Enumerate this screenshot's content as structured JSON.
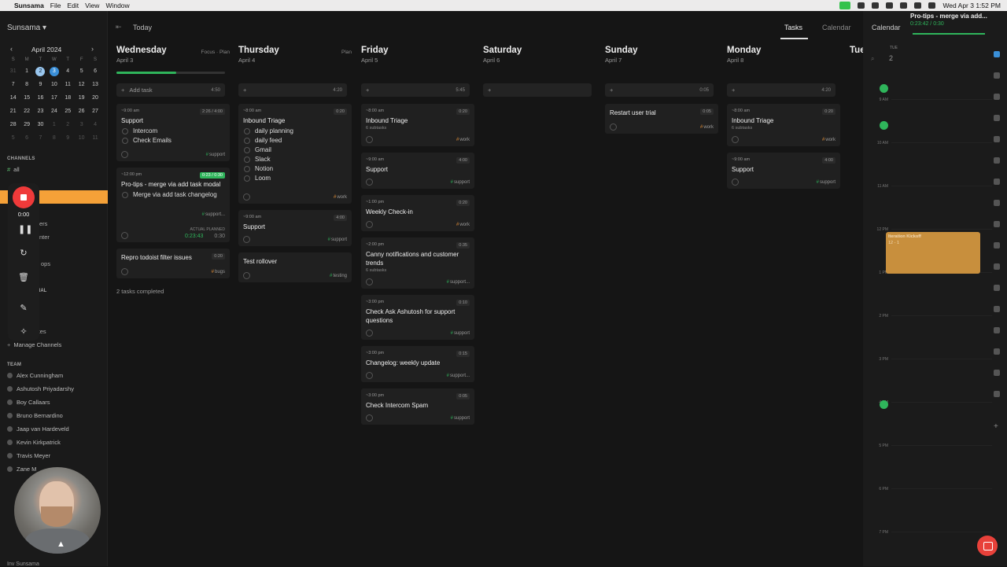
{
  "menubar": {
    "app": "Sunsama",
    "menus": [
      "File",
      "Edit",
      "View",
      "Window"
    ],
    "clock": "Wed Apr 3  1:52 PM"
  },
  "sidebar": {
    "brand": "Sunsama ▾",
    "calendar": {
      "month": "April 2024",
      "dow": [
        "S",
        "M",
        "T",
        "W",
        "T",
        "F",
        "S"
      ],
      "weeks": [
        [
          "31",
          "1",
          "2",
          "3",
          "4",
          "5",
          "6"
        ],
        [
          "7",
          "8",
          "9",
          "10",
          "11",
          "12",
          "13"
        ],
        [
          "14",
          "15",
          "16",
          "17",
          "18",
          "19",
          "20"
        ],
        [
          "21",
          "22",
          "23",
          "24",
          "25",
          "26",
          "27"
        ],
        [
          "28",
          "29",
          "30",
          "1",
          "2",
          "3",
          "4"
        ],
        [
          "5",
          "6",
          "7",
          "8",
          "9",
          "10",
          "11"
        ]
      ]
    },
    "channels_label": "CHANNELS",
    "channel_all": "all",
    "manage_channels": "Manage Channels",
    "team_label": "TEAM",
    "team": [
      "Alex Cunningham",
      "Ashutosh Priyadarshy",
      "Boy Callaars",
      "Bruno Bernardino",
      "Jaap van Hardeveld",
      "Kevin Kirkpatrick",
      "Travis Meyer",
      "Zane M"
    ],
    "fragments": {
      "ers": "ers",
      "nter": "nter",
      "ops": "ops",
      "nal": "NAL",
      "kes": "kes"
    },
    "bottom": "Inv      Sunsama"
  },
  "recorder": {
    "time": "0:00"
  },
  "topbar": {
    "today": "Today",
    "tab_tasks": "Tasks",
    "tab_calendar": "Calendar"
  },
  "days": [
    {
      "name": "Wednesday",
      "date": "April 3",
      "links": "Focus · Plan",
      "add": "Add task",
      "add_dur": "4:50",
      "cards": [
        {
          "time": "~9:00 am",
          "title": "Support",
          "dur": "2:26 / 4:00",
          "subtasks": [
            "Intercom",
            "Check Emails"
          ],
          "tag": "support"
        },
        {
          "time": "~12:00 pm",
          "title": "Pro-tips - merge via add task modal",
          "dur": "0:23 / 0:30",
          "subtasks": [
            "Merge via add task changelog"
          ],
          "tag": "support...",
          "actual_label": "ACTUAL",
          "planned_label": "PLANNED",
          "actual": "0:23:43",
          "planned": "0:30"
        },
        {
          "time": "",
          "title": "Repro todoist filter issues",
          "dur": "0:20",
          "subtasks": [],
          "tag": "bugs"
        }
      ],
      "completed": "2 tasks completed"
    },
    {
      "name": "Thursday",
      "date": "April 4",
      "links": "Plan",
      "add": "",
      "add_dur": "4:20",
      "cards": [
        {
          "time": "~8:00 am",
          "title": "Inbound Triage",
          "dur": "0:20",
          "subtasks": [
            "daily planning",
            "daily feed",
            "Gmail",
            "Slack",
            "Notion",
            "Loom"
          ],
          "tag": "work"
        },
        {
          "time": "~9:00 am",
          "title": "Support",
          "dur": "4:00",
          "subtasks": [],
          "tag": "support"
        },
        {
          "time": "",
          "title": "Test rollover",
          "dur": "",
          "subtasks": [],
          "tag": "testing"
        }
      ]
    },
    {
      "name": "Friday",
      "date": "April 5",
      "links": "",
      "add": "",
      "add_dur": "5:45",
      "cards": [
        {
          "time": "~8:00 am",
          "title": "Inbound Triage",
          "sub": "6 subtasks",
          "dur": "0:20",
          "tag": "work"
        },
        {
          "time": "~9:00 am",
          "title": "Support",
          "dur": "4:00",
          "tag": "support"
        },
        {
          "time": "~1:00 pm",
          "title": "Weekly Check-in",
          "dur": "0:20",
          "tag": "work"
        },
        {
          "time": "~2:00 pm",
          "title": "Canny notifications and customer trends",
          "sub": "6 subtasks",
          "dur": "0:35",
          "tag": "support..."
        },
        {
          "time": "~3:00 pm",
          "title": "Check Ask Ashutosh for support questions",
          "dur": "0:10",
          "tag": "support"
        },
        {
          "time": "~3:00 pm",
          "title": "Changelog: weekly update",
          "dur": "0:15",
          "tag": "support..."
        },
        {
          "time": "~3:00 pm",
          "title": "Check Intercom Spam",
          "dur": "0:05",
          "tag": "support"
        }
      ]
    },
    {
      "name": "Saturday",
      "date": "April 6",
      "links": "",
      "add": "",
      "add_dur": "",
      "cards": []
    },
    {
      "name": "Sunday",
      "date": "April 7",
      "links": "",
      "add": "",
      "add_dur": "0:05",
      "cards": [
        {
          "time": "",
          "title": "Restart user trial",
          "dur": "0:05",
          "tag": "work"
        }
      ]
    },
    {
      "name": "Monday",
      "date": "April 8",
      "links": "",
      "add": "",
      "add_dur": "4:20",
      "cards": [
        {
          "time": "~8:00 am",
          "title": "Inbound Triage",
          "sub": "6 subtasks",
          "dur": "0:20",
          "tag": "work"
        },
        {
          "time": "~9:00 am",
          "title": "Support",
          "dur": "4:00",
          "tag": "support"
        }
      ]
    },
    {
      "name": "Tue",
      "date": "",
      "links": "",
      "add": "",
      "add_dur": "",
      "cards": []
    }
  ],
  "right_panel": {
    "title": "Calendar",
    "day_label": "TUE",
    "day_num": "2",
    "hours": [
      "9 AM",
      "10 AM",
      "11 AM",
      "12 PM",
      "1 PM",
      "2 PM",
      "3 PM",
      "4 PM",
      "5 PM",
      "6 PM",
      "7 PM"
    ],
    "event": {
      "title": "Iteration Kickoff",
      "time": "12 - 1"
    }
  },
  "protip": {
    "title": "Pro-tips - merge via add...",
    "timer": "0:23:42 / 0:30"
  }
}
